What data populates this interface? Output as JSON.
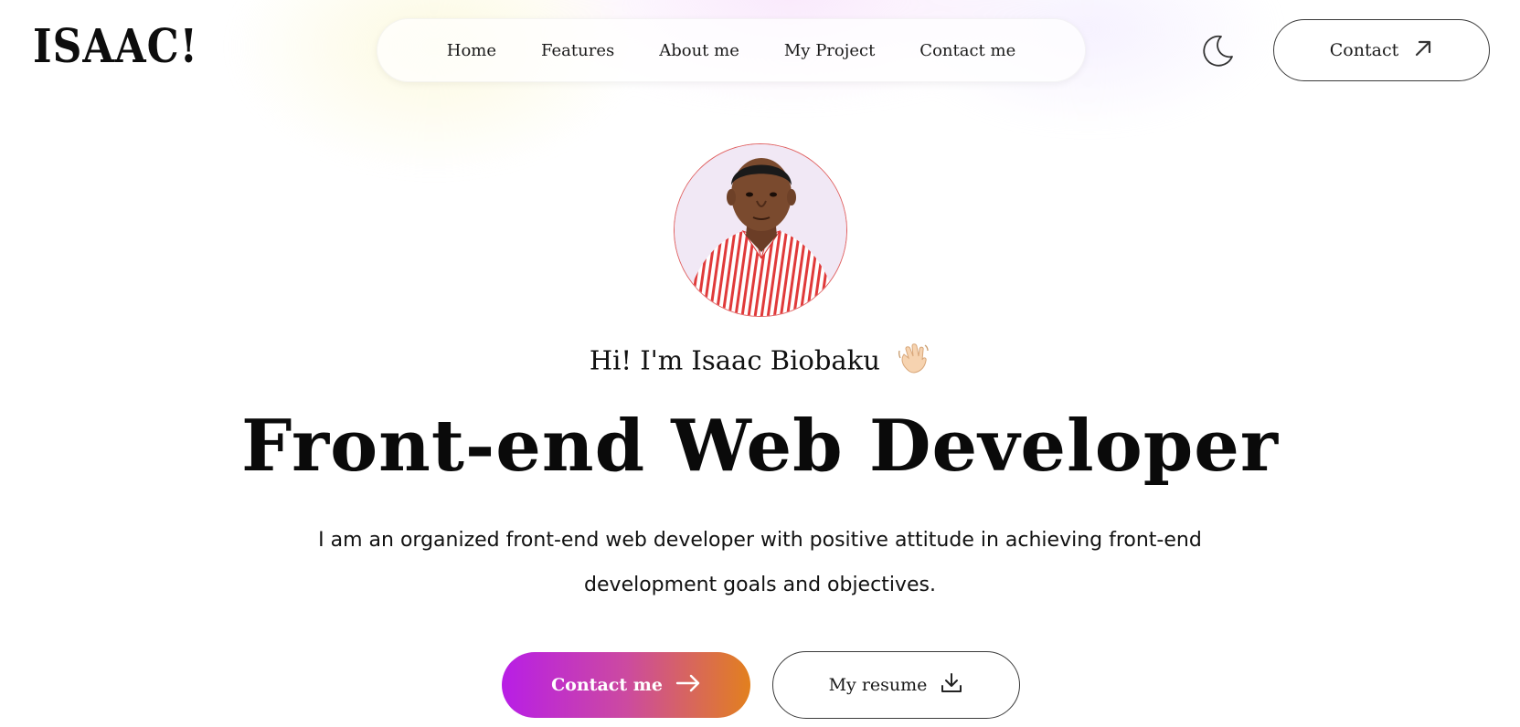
{
  "brand": {
    "logo_text": "ISAAC!"
  },
  "nav": {
    "items": [
      {
        "label": "Home"
      },
      {
        "label": "Features"
      },
      {
        "label": "About me"
      },
      {
        "label": "My Project"
      },
      {
        "label": "Contact me"
      }
    ]
  },
  "header": {
    "theme_toggle_icon": "moon-icon",
    "contact_label": "Contact",
    "contact_icon": "arrow-up-right-icon"
  },
  "hero": {
    "avatar_icon": "profile-photo",
    "greeting": "Hi! I'm Isaac Biobaku",
    "greeting_icon": "waving-hand-icon",
    "headline": "Front-end Web Developer",
    "bio_line1": "I am an organized front-end web developer with positive attitude in achieving front-end",
    "bio_line2": "development goals and objectives.",
    "primary_cta_label": "Contact me",
    "primary_cta_icon": "arrow-right-icon",
    "secondary_cta_label": "My resume",
    "secondary_cta_icon": "download-icon"
  },
  "colors": {
    "cta_gradient_start": "#b81ee6",
    "cta_gradient_end": "#e2801e",
    "avatar_border": "#e06060",
    "shirt_stripe": "#e03a3a"
  }
}
